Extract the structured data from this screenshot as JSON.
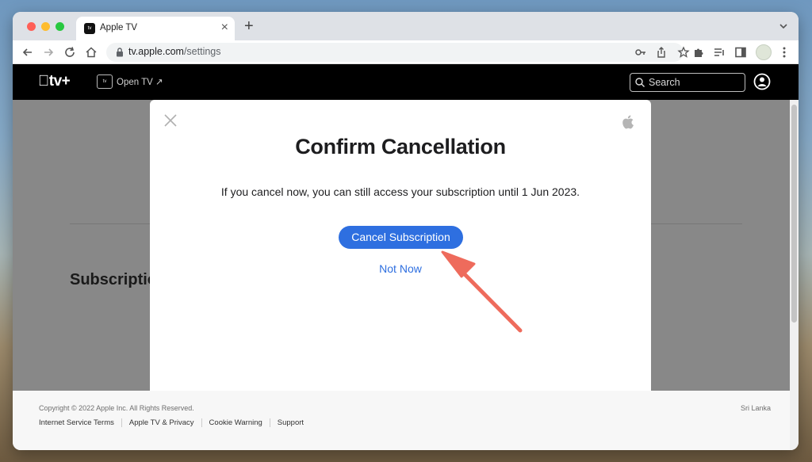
{
  "browser": {
    "tab_title": "Apple TV",
    "tab_favicon_text": "tv",
    "url_host": "tv.apple.com",
    "url_path": "/settings"
  },
  "header": {
    "logo": "tv+",
    "open_tv_icon_text": "tv",
    "open_tv_label": "Open TV ↗",
    "search_placeholder": "Search"
  },
  "page": {
    "heading": "Subscriptio"
  },
  "modal": {
    "title": "Confirm Cancellation",
    "message": "If you cancel now, you can still access your subscription until 1 Jun 2023.",
    "primary_button": "Cancel Subscription",
    "secondary_link": "Not Now"
  },
  "footer": {
    "copyright": "Copyright © 2022 Apple Inc. All Rights Reserved.",
    "region": "Sri Lanka",
    "links": [
      "Internet Service Terms",
      "Apple TV & Privacy",
      "Cookie Warning",
      "Support"
    ]
  },
  "colors": {
    "accent": "#2e6fe0",
    "annotation_arrow": "#ee6b5c"
  }
}
